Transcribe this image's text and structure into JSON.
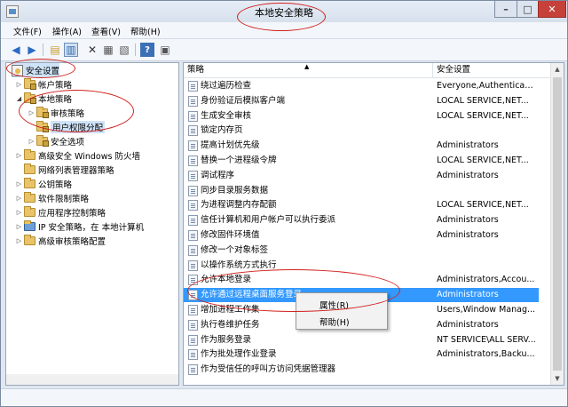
{
  "window": {
    "title": "本地安全策略",
    "buttons": [
      "–",
      "□",
      "✕"
    ]
  },
  "menu": [
    "文件(F)",
    "操作(A)",
    "查看(V)",
    "帮助(H)"
  ],
  "toolbar": [
    "back-icon",
    "forward-icon",
    "up-folder-icon",
    "show-tree-icon",
    "delete-icon",
    "properties-icon",
    "export-icon",
    "help-icon",
    "console-icon"
  ],
  "tree": [
    {
      "label": "安全设置",
      "level": 0,
      "twisty": ""
    },
    {
      "label": "帐户策略",
      "level": 1,
      "twisty": "▷"
    },
    {
      "label": "本地策略",
      "level": 1,
      "twisty": "◢"
    },
    {
      "label": "审核策略",
      "level": 2,
      "twisty": "▷"
    },
    {
      "label": "用户权限分配",
      "level": 2,
      "twisty": ""
    },
    {
      "label": "安全选项",
      "level": 2,
      "twisty": "▷"
    },
    {
      "label": "高级安全 Windows 防火墙",
      "level": 1,
      "twisty": "▷"
    },
    {
      "label": "网络列表管理器策略",
      "level": 1,
      "twisty": ""
    },
    {
      "label": "公钥策略",
      "level": 1,
      "twisty": "▷"
    },
    {
      "label": "软件限制策略",
      "level": 1,
      "twisty": "▷"
    },
    {
      "label": "应用程序控制策略",
      "level": 1,
      "twisty": "▷"
    },
    {
      "label": "IP 安全策略，在 本地计算机",
      "level": 1,
      "twisty": "▷"
    },
    {
      "label": "高级审核策略配置",
      "level": 1,
      "twisty": "▷"
    }
  ],
  "columns": {
    "policy": "策略",
    "setting": "安全设置"
  },
  "rows": [
    {
      "policy": "绕过遍历检查",
      "setting": "Everyone,Authenticate..."
    },
    {
      "policy": "身份验证后模拟客户端",
      "setting": "LOCAL SERVICE,NET..."
    },
    {
      "policy": "生成安全审核",
      "setting": "LOCAL SERVICE,NET..."
    },
    {
      "policy": "锁定内存页",
      "setting": ""
    },
    {
      "policy": "提高计划优先级",
      "setting": "Administrators"
    },
    {
      "policy": "替换一个进程级令牌",
      "setting": "LOCAL SERVICE,NET..."
    },
    {
      "policy": "调试程序",
      "setting": "Administrators"
    },
    {
      "policy": "同步目录服务数据",
      "setting": ""
    },
    {
      "policy": "为进程调整内存配额",
      "setting": "LOCAL SERVICE,NET..."
    },
    {
      "policy": "信任计算机和用户帐户可以执行委派",
      "setting": "Administrators"
    },
    {
      "policy": "修改固件环境值",
      "setting": "Administrators"
    },
    {
      "policy": "修改一个对象标签",
      "setting": ""
    },
    {
      "policy": "以操作系统方式执行",
      "setting": ""
    },
    {
      "policy": "允许本地登录",
      "setting": "Administrators,Accou..."
    },
    {
      "policy": "允许通过远程桌面服务登录",
      "setting": "Administrators",
      "selected": true
    },
    {
      "policy": "增加进程工作集",
      "setting": "Users,Window Manag..."
    },
    {
      "policy": "执行卷维护任务",
      "setting": "Administrators"
    },
    {
      "policy": "作为服务登录",
      "setting": "NT SERVICE\\ALL SERV..."
    },
    {
      "policy": "作为批处理作业登录",
      "setting": "Administrators,Backu..."
    },
    {
      "policy": "作为受信任的呼叫方访问凭据管理器",
      "setting": ""
    }
  ],
  "context_menu": [
    "属性(R)",
    "帮助(H)"
  ]
}
